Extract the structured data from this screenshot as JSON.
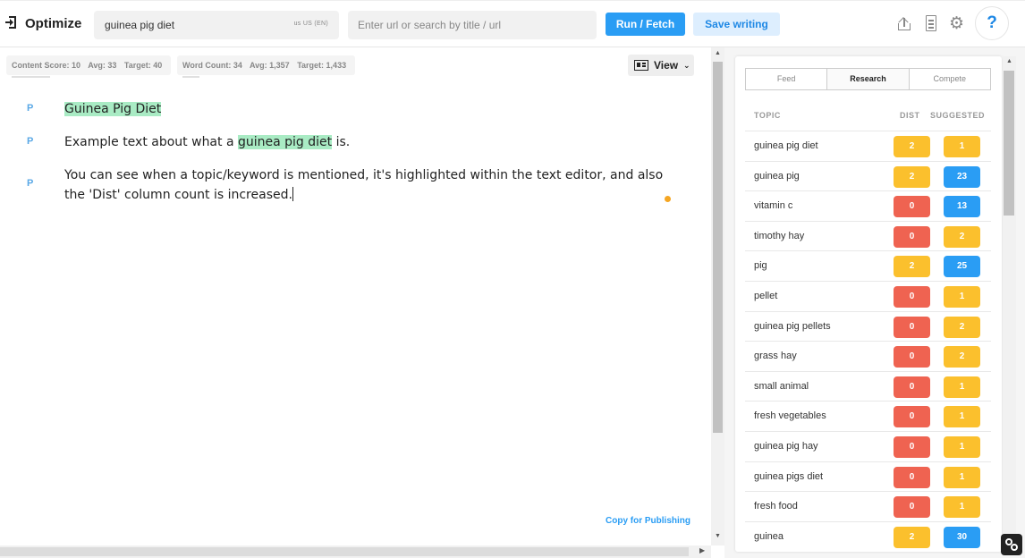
{
  "header": {
    "app_title": "Optimize",
    "keyword": "guinea pig diet",
    "locale": "us  US (EN)",
    "url_placeholder": "Enter url or search by title / url",
    "run_label": "Run / Fetch",
    "save_label": "Save writing",
    "help_label": "?"
  },
  "metrics": {
    "content_score": {
      "label": "Content Score: 10",
      "avg": "Avg: 33",
      "target": "Target: 40",
      "progress": 0.25
    },
    "word_count": {
      "label": "Word Count: 34",
      "avg": "Avg: 1,357",
      "target": "Target: 1,433",
      "progress": 0.1
    }
  },
  "view": {
    "label": "View",
    "chevron": "⌄"
  },
  "editor": {
    "paragraphs": [
      {
        "tag": "P",
        "parts": [
          "",
          "Guinea Pig Diet",
          ""
        ]
      },
      {
        "tag": "P",
        "parts": [
          "Example text about what a ",
          "guinea pig diet",
          " is."
        ]
      },
      {
        "tag": "P",
        "text": "You can see when a topic/keyword is mentioned, it's highlighted within the text editor, and also the 'Dist' column count is increased."
      }
    ],
    "copy_label": "Copy for Publishing"
  },
  "panel": {
    "tabs": [
      "Feed",
      "Research",
      "Compete"
    ],
    "active_tab": "Research",
    "headers": {
      "topic": "TOPIC",
      "dist": "DIST",
      "suggested": "SUGGESTED"
    },
    "rows": [
      {
        "topic": "guinea pig diet",
        "dist": "2",
        "dist_color": "#fbc02d",
        "suggested": "1",
        "sugg_color": "#fbc02d"
      },
      {
        "topic": "guinea pig",
        "dist": "2",
        "dist_color": "#fbc02d",
        "suggested": "23",
        "sugg_color": "#2a9df4"
      },
      {
        "topic": "vitamin c",
        "dist": "0",
        "dist_color": "#ef6351",
        "suggested": "13",
        "sugg_color": "#2a9df4"
      },
      {
        "topic": "timothy hay",
        "dist": "0",
        "dist_color": "#ef6351",
        "suggested": "2",
        "sugg_color": "#fbc02d"
      },
      {
        "topic": "pig",
        "dist": "2",
        "dist_color": "#fbc02d",
        "suggested": "25",
        "sugg_color": "#2a9df4"
      },
      {
        "topic": "pellet",
        "dist": "0",
        "dist_color": "#ef6351",
        "suggested": "1",
        "sugg_color": "#fbc02d"
      },
      {
        "topic": "guinea pig pellets",
        "dist": "0",
        "dist_color": "#ef6351",
        "suggested": "2",
        "sugg_color": "#fbc02d"
      },
      {
        "topic": "grass hay",
        "dist": "0",
        "dist_color": "#ef6351",
        "suggested": "2",
        "sugg_color": "#fbc02d"
      },
      {
        "topic": "small animal",
        "dist": "0",
        "dist_color": "#ef6351",
        "suggested": "1",
        "sugg_color": "#fbc02d"
      },
      {
        "topic": "fresh vegetables",
        "dist": "0",
        "dist_color": "#ef6351",
        "suggested": "1",
        "sugg_color": "#fbc02d"
      },
      {
        "topic": "guinea pig hay",
        "dist": "0",
        "dist_color": "#ef6351",
        "suggested": "1",
        "sugg_color": "#fbc02d"
      },
      {
        "topic": "guinea pigs diet",
        "dist": "0",
        "dist_color": "#ef6351",
        "suggested": "1",
        "sugg_color": "#fbc02d"
      },
      {
        "topic": "fresh food",
        "dist": "0",
        "dist_color": "#ef6351",
        "suggested": "1",
        "sugg_color": "#fbc02d"
      },
      {
        "topic": "guinea",
        "dist": "2",
        "dist_color": "#fbc02d",
        "suggested": "30",
        "sugg_color": "#2a9df4"
      }
    ]
  },
  "icons": {
    "brand": "exit-door-icon",
    "upload": "upload-icon",
    "document": "document-icon",
    "settings": "gear-icon",
    "view": "view-layout-icon",
    "corner": "link-icon"
  }
}
